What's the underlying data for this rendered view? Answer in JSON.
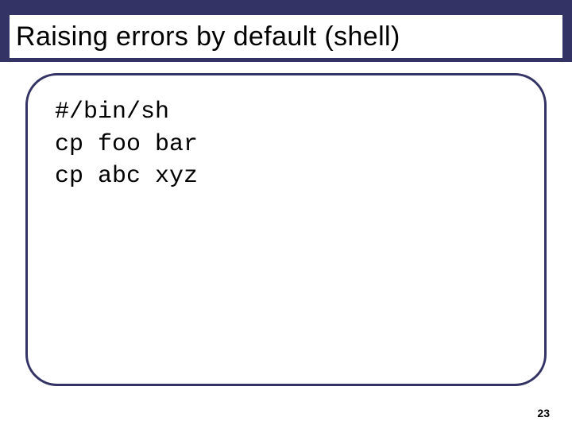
{
  "slide": {
    "title": "Raising errors by default (shell)",
    "code": {
      "line1": "#/bin/sh",
      "blank": "",
      "line2": "cp foo bar",
      "line3": "cp abc xyz"
    },
    "page_number": "23"
  }
}
